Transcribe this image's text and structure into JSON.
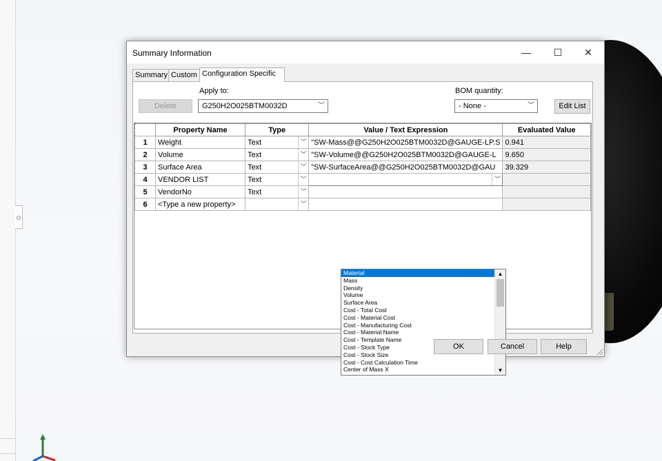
{
  "dialog": {
    "title": "Summary Information",
    "window_buttons": {
      "minimize": "—",
      "maximize": "☐",
      "close": "✕"
    },
    "tabs": [
      {
        "label": "Summary"
      },
      {
        "label": "Custom"
      },
      {
        "label": "Configuration Specific",
        "active": true
      }
    ],
    "apply_to_label": "Apply to:",
    "config_value": "G250H2O025BTM0032D",
    "bom_label": "BOM quantity:",
    "bom_value": "- None -",
    "delete_label": "Delete",
    "edit_list_label": "Edit List",
    "footer": {
      "ok": "OK",
      "cancel": "Cancel",
      "help": "Help"
    }
  },
  "table": {
    "headers": [
      "Property Name",
      "Type",
      "Value / Text Expression",
      "Evaluated Value"
    ],
    "rows": [
      {
        "num": "1",
        "name": "Weight",
        "type": "Text",
        "value": "\"SW-Mass@@G250H2O025BTM0032D@GAUGE-LP.S",
        "evaluated": "0.941"
      },
      {
        "num": "2",
        "name": "Volume",
        "type": "Text",
        "value": "\"SW-Volume@@G250H2O025BTM0032D@GAUGE-L",
        "evaluated": "9.650"
      },
      {
        "num": "3",
        "name": "Surface Area",
        "type": "Text",
        "value": "\"SW-SurfaceArea@@G250H2O025BTM0032D@GAU",
        "evaluated": "39.329"
      },
      {
        "num": "4",
        "name": "VENDOR LIST",
        "type": "Text",
        "value": "",
        "evaluated": ""
      },
      {
        "num": "5",
        "name": "VendorNo",
        "type": "Text",
        "value": "",
        "evaluated": ""
      },
      {
        "num": "6",
        "name": "<Type a new property>",
        "type": "",
        "value": "",
        "evaluated": ""
      }
    ]
  },
  "dropdown_items": [
    "Material",
    "Mass",
    "Density",
    "Volume",
    "Surface Area",
    "Cost - Total Cost",
    "Cost - Material Cost",
    "Cost - Manufacturing Cost",
    "Cost - Material Name",
    "Cost - Template Name",
    "Cost - Stock Type",
    "Cost - Stock Size",
    "Cost - Cost Calculation Time",
    "Center of Mass X"
  ],
  "dropdown_selected": "Material",
  "colors": {
    "selection": "#0078d7",
    "dialog_bg": "#f0f0f0"
  },
  "icons": [
    "dropdown-arrow-icon",
    "scroll-up-icon",
    "scroll-down-icon",
    "resize-grip-icon",
    "axis-triad-icon"
  ]
}
